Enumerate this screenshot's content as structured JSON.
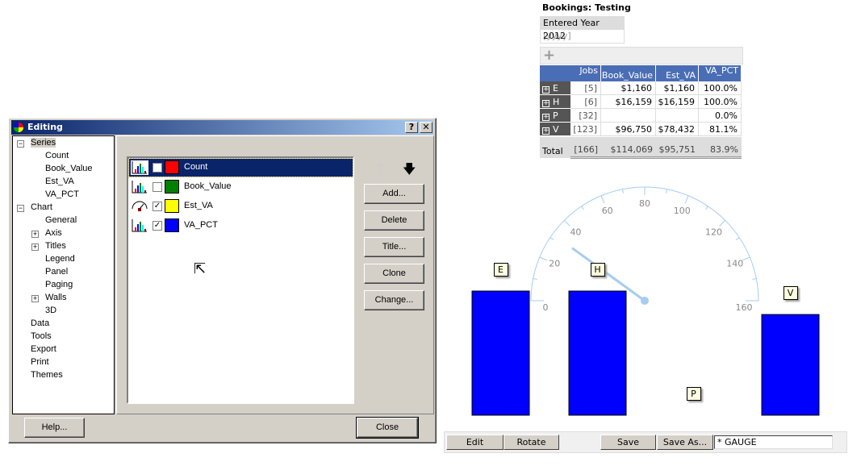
{
  "dialog": {
    "title": "Editing",
    "help_btn": "?",
    "close_btn": "✕",
    "tree": [
      {
        "label": "Series",
        "level": 0,
        "expander": "-"
      },
      {
        "label": "Count",
        "level": 1
      },
      {
        "label": "Book_Value",
        "level": 1
      },
      {
        "label": "Est_VA",
        "level": 1
      },
      {
        "label": "VA_PCT",
        "level": 1
      },
      {
        "label": "Chart",
        "level": 0,
        "expander": "-"
      },
      {
        "label": "General",
        "level": 1
      },
      {
        "label": "Axis",
        "level": 1,
        "expander": "+"
      },
      {
        "label": "Titles",
        "level": 1,
        "expander": "+"
      },
      {
        "label": "Legend",
        "level": 1
      },
      {
        "label": "Panel",
        "level": 1
      },
      {
        "label": "Paging",
        "level": 1
      },
      {
        "label": "Walls",
        "level": 1,
        "expander": "+"
      },
      {
        "label": "3D",
        "level": 1
      },
      {
        "label": "Data",
        "level": 0
      },
      {
        "label": "Tools",
        "level": 0
      },
      {
        "label": "Export",
        "level": 0
      },
      {
        "label": "Print",
        "level": 0
      },
      {
        "label": "Themes",
        "level": 0
      }
    ],
    "series": [
      {
        "name": "Count",
        "icon": "bar-chart-icon",
        "checked": false,
        "color": "#ff0000",
        "selected": true
      },
      {
        "name": "Book_Value",
        "icon": "bar-chart-icon",
        "checked": false,
        "color": "#008000"
      },
      {
        "name": "Est_VA",
        "icon": "gauge-icon",
        "checked": true,
        "color": "#ffff00"
      },
      {
        "name": "VA_PCT",
        "icon": "bar-chart-icon",
        "checked": true,
        "color": "#0000ff"
      }
    ],
    "buttons": {
      "add": "Add...",
      "delete": "Delete",
      "title": "Title...",
      "clone": "Clone",
      "change": "Change...",
      "help": "Help...",
      "close": "Close"
    }
  },
  "report": {
    "title": "Bookings: Testing",
    "param_label": "Entered Year",
    "param_hint": "[yyyy]",
    "param_value": "2012",
    "add_icon": "+",
    "columns": [
      "Jobs",
      "Book_Value",
      "Est_VA",
      "VA_PCT"
    ],
    "rows": [
      {
        "key": "E",
        "cells": [
          "[5]",
          "$1,160",
          "$1,160",
          "100.0%"
        ]
      },
      {
        "key": "H",
        "cells": [
          "[6]",
          "$16,159",
          "$16,159",
          "100.0%"
        ]
      },
      {
        "key": "P",
        "cells": [
          "[32]",
          "",
          "",
          "0.0%"
        ]
      },
      {
        "key": "V",
        "cells": [
          "[123]",
          "$96,750",
          "$78,432",
          "81.1%"
        ]
      }
    ],
    "total": {
      "label": "Total",
      "cells": [
        "[166]",
        "$114,069",
        "$95,751",
        "83.9%"
      ]
    }
  },
  "chart_data": {
    "type": "bar",
    "categories": [
      "E",
      "H",
      "P",
      "V"
    ],
    "series": [
      {
        "values": [
          100,
          100,
          0,
          81.1
        ],
        "color": "#0000ff"
      }
    ],
    "gauge": {
      "min": 0,
      "max": 160,
      "ticks": [
        0,
        20,
        40,
        60,
        80,
        100,
        120,
        140,
        160
      ],
      "value": 32,
      "color": "#a6ccf0"
    }
  },
  "toolbar": {
    "edit": "Edit",
    "rotate": "Rotate",
    "save": "Save",
    "save_as": "Save As...",
    "name_value": "* GAUGE"
  }
}
